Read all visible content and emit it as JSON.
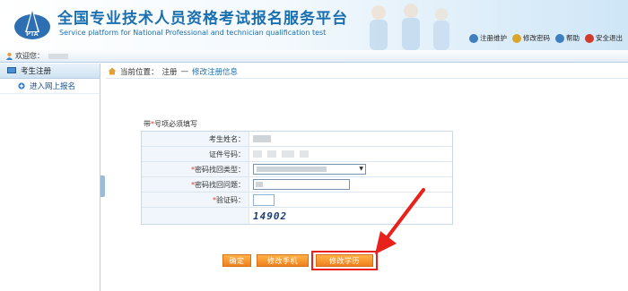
{
  "header": {
    "title_cn": "全国专业技术人员资格考试报名服务平台",
    "title_en": "Service platform for National Professional and technician qualification test",
    "tools": [
      {
        "label": "注册维护",
        "icon": "user-maintain-icon",
        "color": "#3d7fc0"
      },
      {
        "label": "修改密码",
        "icon": "key-icon",
        "color": "#d9a62c"
      },
      {
        "label": "帮助",
        "icon": "help-icon",
        "color": "#3d7fc0"
      },
      {
        "label": "安全退出",
        "icon": "exit-icon",
        "color": "#d23b2a"
      }
    ]
  },
  "welcome": {
    "label": "欢迎您："
  },
  "sidebar": {
    "header": "考生注册",
    "items": [
      {
        "label": "进入网上报名"
      }
    ]
  },
  "breadcrumb": {
    "prefix": "当前位置：",
    "item1": "注册",
    "separator": "—",
    "item2": "修改注册信息"
  },
  "form": {
    "note_prefix": "带",
    "note_star": "*",
    "note_suffix": "号项必须填写",
    "rows": [
      {
        "label": "考生姓名：",
        "required": false
      },
      {
        "label": "证件号码：",
        "required": false
      },
      {
        "label": "密码找回类型：",
        "required": true
      },
      {
        "label": "密码找回问题：",
        "required": true
      },
      {
        "label": "验证码：",
        "required": true
      }
    ],
    "captcha_text": "14902"
  },
  "buttons": {
    "confirm": "确定",
    "change_phone": "修改手机",
    "change_edu": "修改学历"
  },
  "colors": {
    "accent": "#1a6fb0",
    "button": "#f0801c",
    "highlight": "#e8221a"
  }
}
